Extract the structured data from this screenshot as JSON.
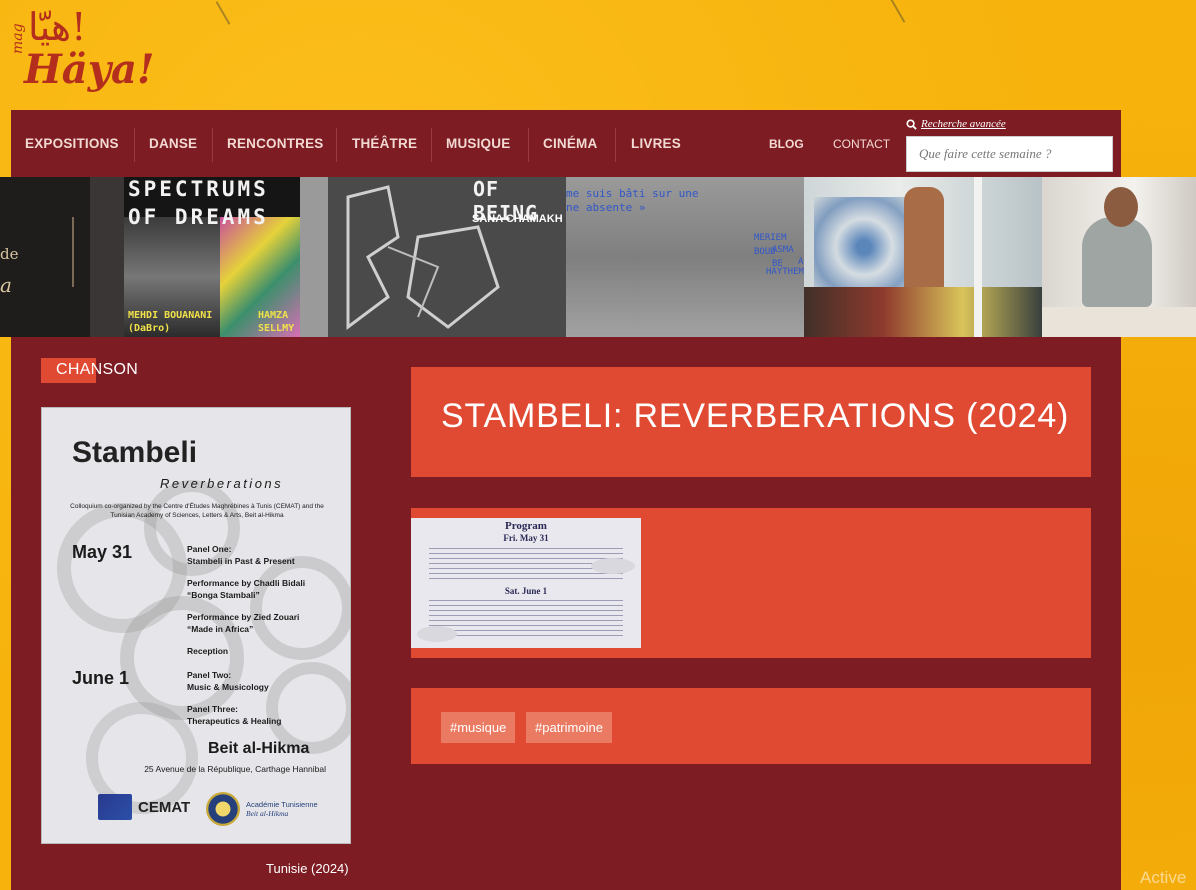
{
  "logo": {
    "mag": "mag",
    "arabic": "هيّا!",
    "latin": "Häya!"
  },
  "nav": {
    "items": [
      "EXPOSITIONS",
      "DANSE",
      "RENCONTRES",
      "THÉÂTRE",
      "MUSIQUE",
      "CINÉMA",
      "LIVRES"
    ],
    "blog": "BLOG",
    "contact": "CONTACT",
    "advanced_search": "Recherche avancée",
    "search_placeholder": "Que faire cette semaine ?"
  },
  "banner": {
    "tile2_line1": "SPECTRUMS",
    "tile2_line2": "OF DREAMS",
    "tile2_artist1_line1": "MEHDI BOUANANI",
    "tile2_artist1_line2": "(DaBro)",
    "tile2_artist2_line1": "HAMZA",
    "tile2_artist2_line2": "SELLMY",
    "tile3_title": "OF BEING",
    "tile3_artist": "SANA CHAMAKH",
    "tile4_line1": "me suis bâti sur une",
    "tile4_line2": "ne absente »",
    "tile4_names": [
      "MERIEM BOUD",
      "ASMA BE",
      "A",
      "HAYTHEM"
    ],
    "tile1_word": "de"
  },
  "main": {
    "category": "CHANSON",
    "title": "STAMBELI: REVERBERATIONS (2024)",
    "caption": "Tunisie (2024)",
    "tags": [
      "#musique",
      "#patrimoine"
    ]
  },
  "poster": {
    "title": "Stambeli",
    "subtitle": "Reverberations",
    "intro": "Colloquium co-organized by the Centre d'Études Maghrébines à Tunis (CEMAT) and the Tunisian Academy of Sciences, Letters & Arts, Beit al-Hikma",
    "day1": "May 31",
    "day1_items": [
      {
        "head": "Panel One:",
        "body": "Stambeli in Past & Present"
      },
      {
        "head": "Performance by Chadli Bidali",
        "body": "“Bonga Stambali”"
      },
      {
        "head": "Performance by Zied Zouari",
        "body": "“Made in Africa”"
      },
      {
        "head": "Reception",
        "body": ""
      }
    ],
    "day2": "June 1",
    "day2_items": [
      {
        "head": "Panel Two:",
        "body": "Music & Musicology"
      },
      {
        "head": "Panel Three:",
        "body": "Therapeutics & Healing"
      }
    ],
    "venue": "Beit al-Hikma",
    "address": "25 Avenue de la République, Carthage Hannibal",
    "logo1": "CEMAT",
    "logo2_line1": "Académie Tunisienne",
    "logo2_line2": "Beit al-Hikma"
  },
  "program": {
    "title": "Program",
    "day1": "Fri. May 31",
    "day2": "Sat. June 1"
  },
  "system": {
    "activate": "Active"
  },
  "colors": {
    "accent": "#e04a32",
    "panel": "#7d1c22",
    "background": "#f7b20c"
  }
}
